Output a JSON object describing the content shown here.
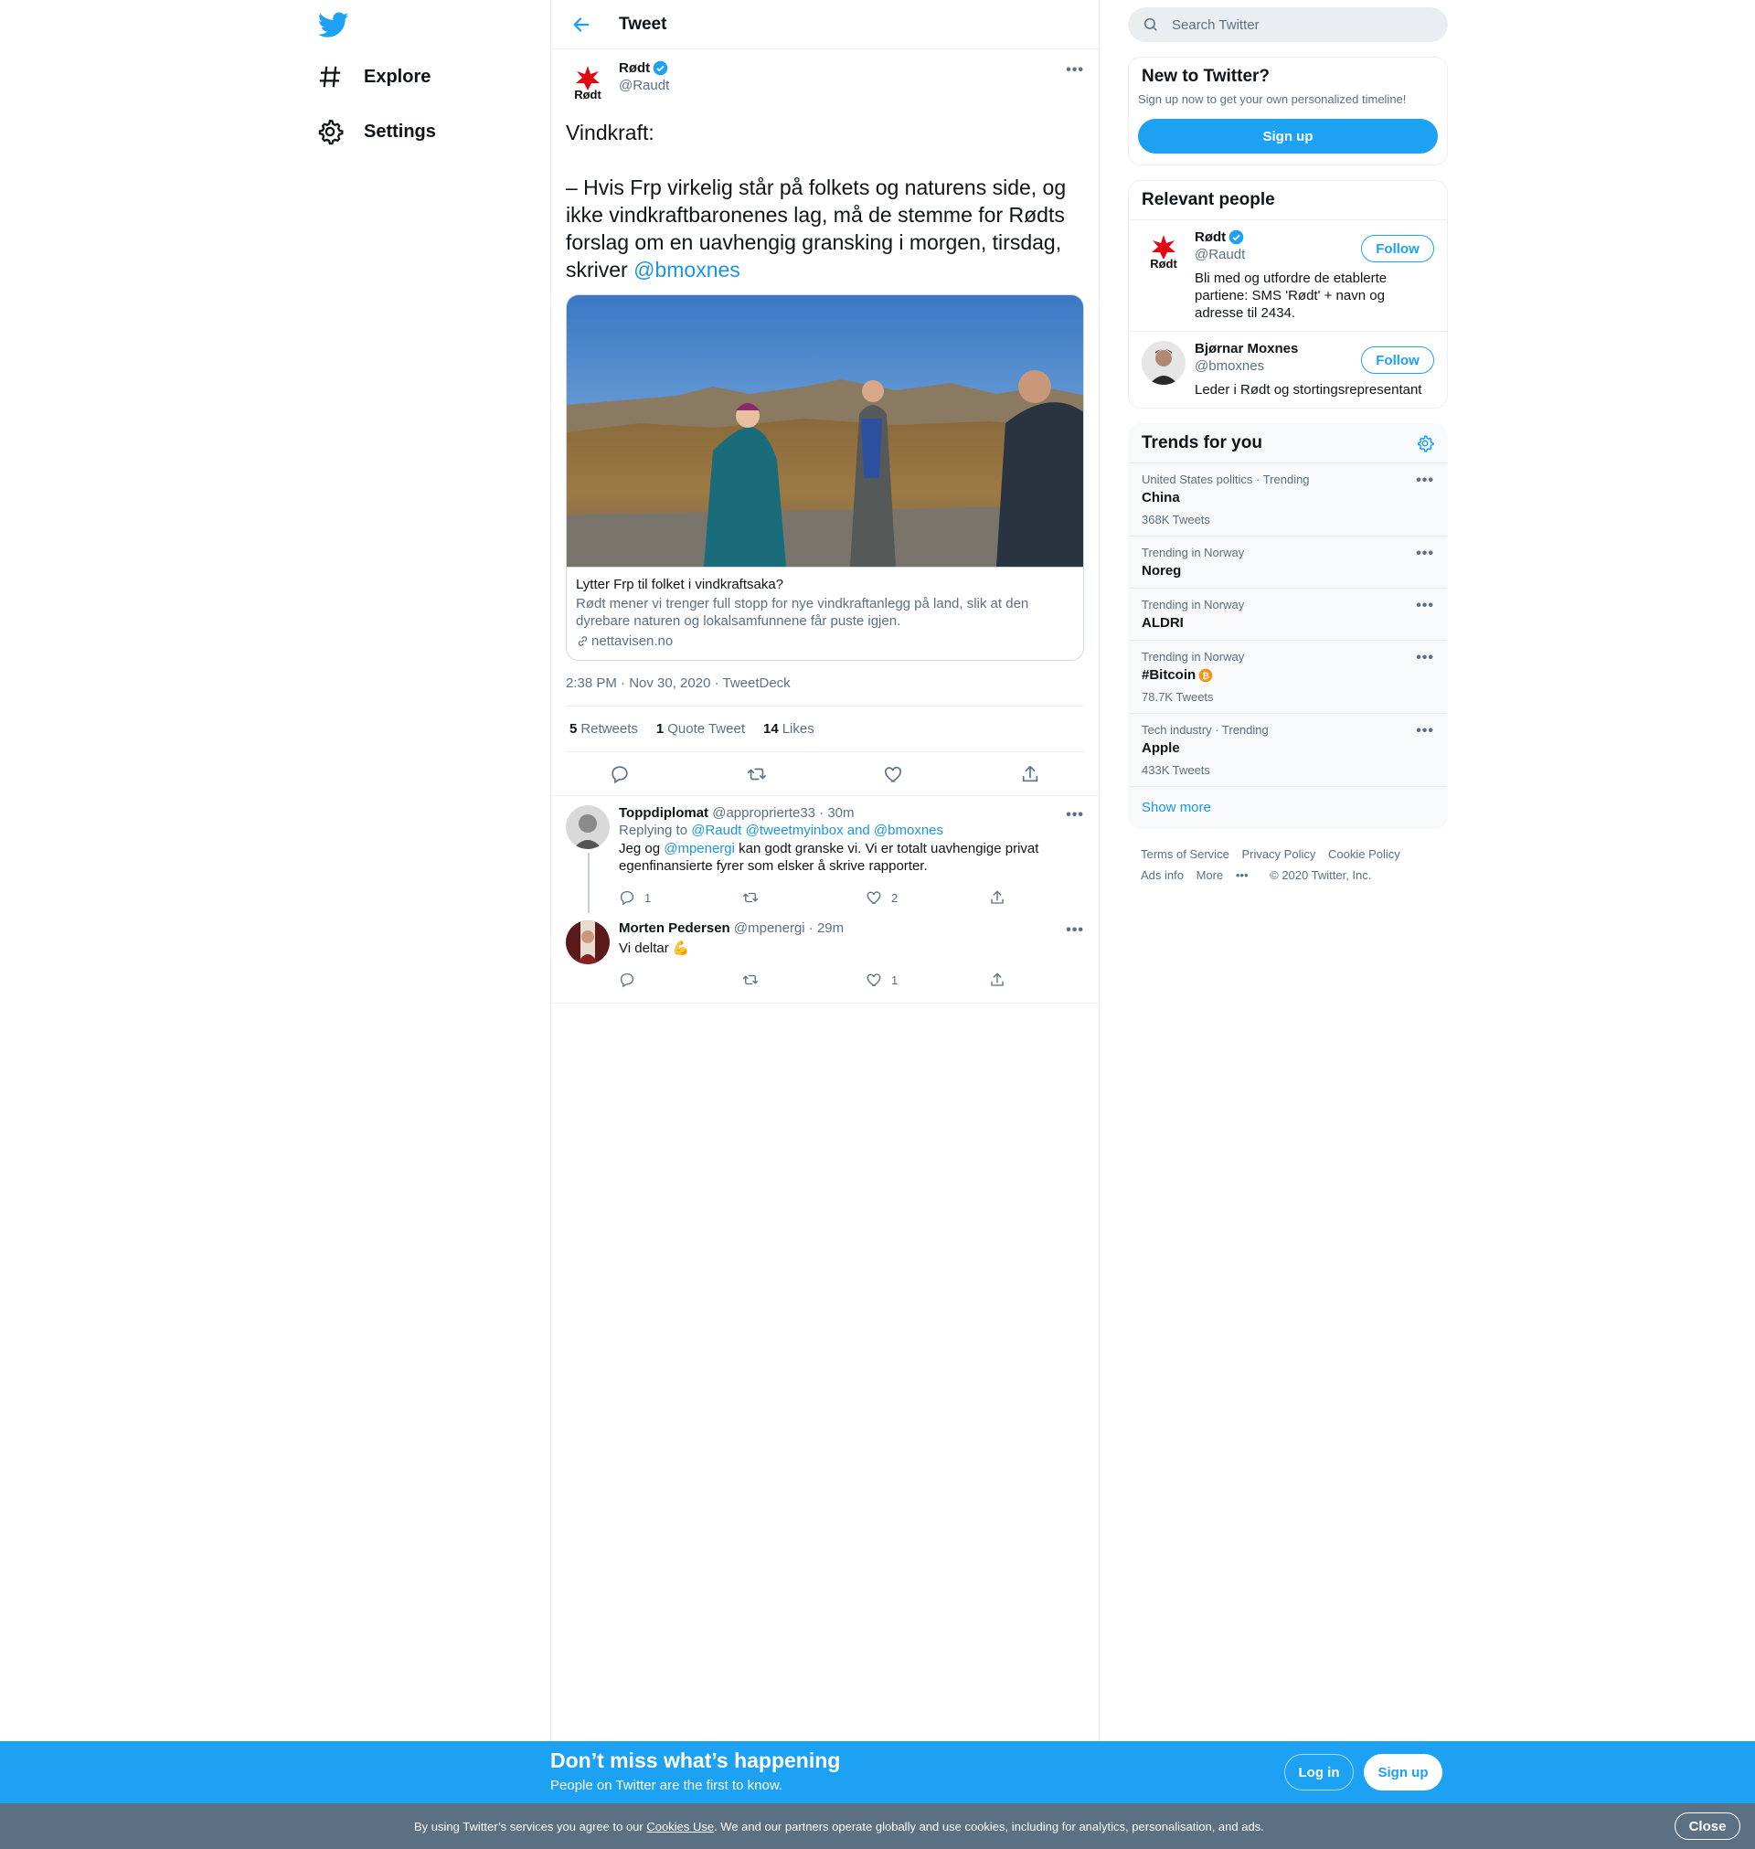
{
  "nav": {
    "logo_icon": "twitter-bird-icon",
    "explore_label": "Explore",
    "settings_label": "Settings"
  },
  "header": {
    "title": "Tweet"
  },
  "tweet": {
    "author_name": "Rødt",
    "author_handle": "@Raudt",
    "avatar_logo_text": "Rødt",
    "text_before_mention": "Vindkraft:\n\n– Hvis Frp virkelig står på folkets og naturens side, og ikke vindkraftbaronenes lag, må de stemme for Rødts forslag om en uavhengig gransking i morgen, tirsdag, skriver ",
    "mention": "@bmoxnes",
    "card": {
      "title": "Lytter Frp til folket i vindkraftsaka?",
      "description": "Rødt mener vi trenger full stopp for nye vindkraftanlegg på land, slik at den dyrebare naturen og lokalsamfunnene får puste igjen.",
      "domain": "nettavisen.no"
    },
    "timestamp": "2:38 PM · Nov 30, 2020 · TweetDeck",
    "stats": {
      "retweets_count": "5",
      "retweets_label": "Retweets",
      "quotes_count": "1",
      "quotes_label": "Quote Tweet",
      "likes_count": "14",
      "likes_label": "Likes"
    }
  },
  "replies": [
    {
      "name": "Toppdiplomat",
      "meta": "@approprierte33 · 30m",
      "replying_prefix": "Replying to",
      "replying_to": "@Raudt @tweetmyinbox and @bmoxnes",
      "text_before": "Jeg og ",
      "text_mention": "@mpenergi",
      "text_after": " kan godt granske vi. Vi er totalt uavhengige privat egenfinansierte fyrer som elsker å skrive rapporter.",
      "reply_count": "1",
      "retweet_count": "",
      "like_count": "2"
    },
    {
      "name": "Morten Pedersen",
      "meta": "@mpenergi · 29m",
      "text": "Vi deltar 💪",
      "reply_count": "",
      "retweet_count": "",
      "like_count": "1"
    }
  ],
  "search": {
    "placeholder": "Search Twitter"
  },
  "new_to_twitter": {
    "title": "New to Twitter?",
    "subtitle": "Sign up now to get your own personalized timeline!",
    "signup_label": "Sign up"
  },
  "relevant_people": {
    "title": "Relevant people",
    "follow_label": "Follow",
    "people": [
      {
        "name": "Rødt",
        "handle": "@Raudt",
        "bio": "Bli med og utfordre de etablerte partiene: SMS 'Rødt' + navn og adresse til 2434."
      },
      {
        "name": "Bjørnar Moxnes",
        "handle": "@bmoxnes",
        "bio": "Leder i Rødt og stortingsrepresentant"
      }
    ]
  },
  "trends": {
    "title": "Trends for you",
    "items": [
      {
        "context": "United States politics · Trending",
        "name": "China",
        "count": "368K Tweets"
      },
      {
        "context": "Trending in Norway",
        "name": "Noreg",
        "count": ""
      },
      {
        "context": "Trending in Norway",
        "name": "ALDRI",
        "count": ""
      },
      {
        "context": "Trending in Norway",
        "name": "#Bitcoin",
        "count": "78.7K Tweets"
      },
      {
        "context": "Tech industry · Trending",
        "name": "Apple",
        "count": "433K Tweets"
      }
    ],
    "show_more": "Show more"
  },
  "footer": {
    "terms": "Terms of Service",
    "privacy": "Privacy Policy",
    "cookie": "Cookie Policy",
    "ads": "Ads info",
    "more": "More",
    "copyright": "© 2020 Twitter, Inc."
  },
  "bottom_bar": {
    "title": "Don’t miss what’s happening",
    "subtitle": "People on Twitter are the first to know.",
    "login_label": "Log in",
    "signup_label": "Sign up"
  },
  "cookie_bar": {
    "text_before": "By using Twitter’s services you agree to our ",
    "link": "Cookies Use",
    "text_after": ". We and our partners operate globally and use cookies, including for analytics, personalisation, and ads.",
    "close_label": "Close"
  },
  "colors": {
    "accent": "#1da1f2",
    "link": "#1b95e0",
    "muted": "#5b7083",
    "rodt_red": "#e30613"
  }
}
